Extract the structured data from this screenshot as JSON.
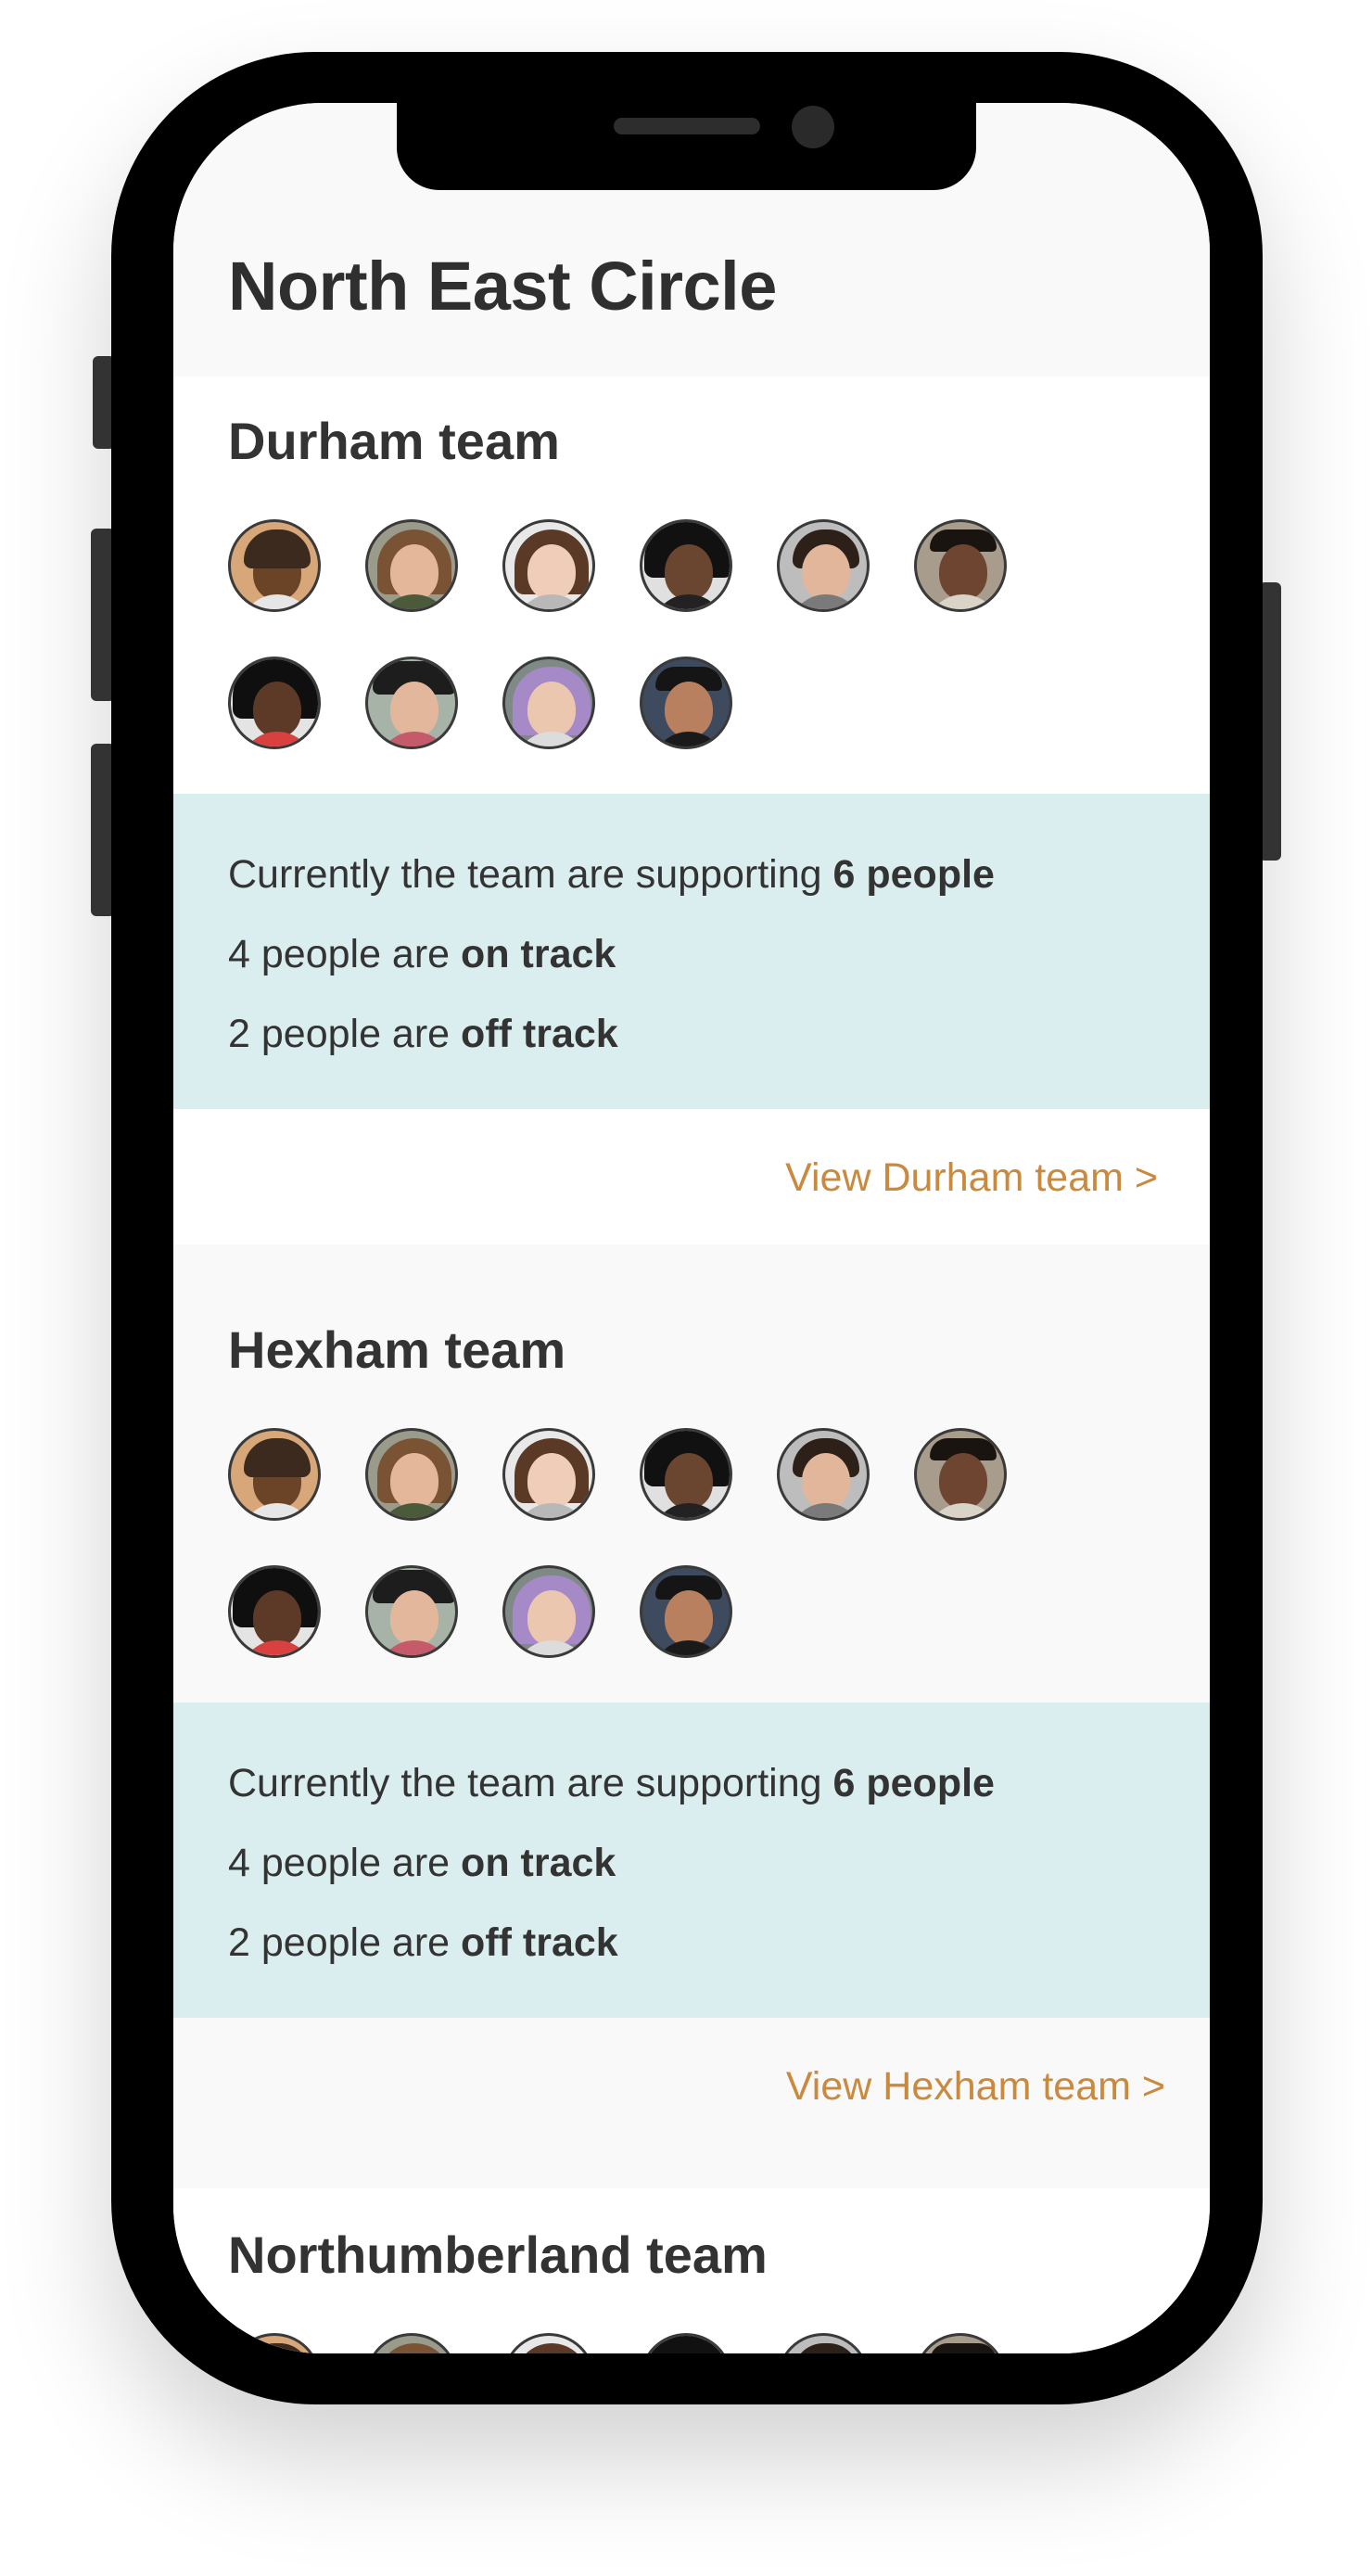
{
  "page": {
    "title": "North East Circle"
  },
  "colors": {
    "accent": "#c98a3f",
    "stats_bg": "#dbeeef",
    "background": "#f9f9f9"
  },
  "teams": [
    {
      "name": "Durham team",
      "stats": {
        "supporting_prefix": "Currently the team are supporting",
        "supporting_value": "6 people",
        "on_track_prefix": "4 people are",
        "on_track_value": "on track",
        "off_track_prefix": "2 people are",
        "off_track_value": "off track"
      },
      "link": "View Durham team >"
    },
    {
      "name": "Hexham team",
      "stats": {
        "supporting_prefix": "Currently the team are supporting",
        "supporting_value": "6 people",
        "on_track_prefix": "4 people are",
        "on_track_value": "on track",
        "off_track_prefix": "2 people are",
        "off_track_value": "off track"
      },
      "link": "View Hexham team >"
    },
    {
      "name": "Northumberland team"
    }
  ]
}
